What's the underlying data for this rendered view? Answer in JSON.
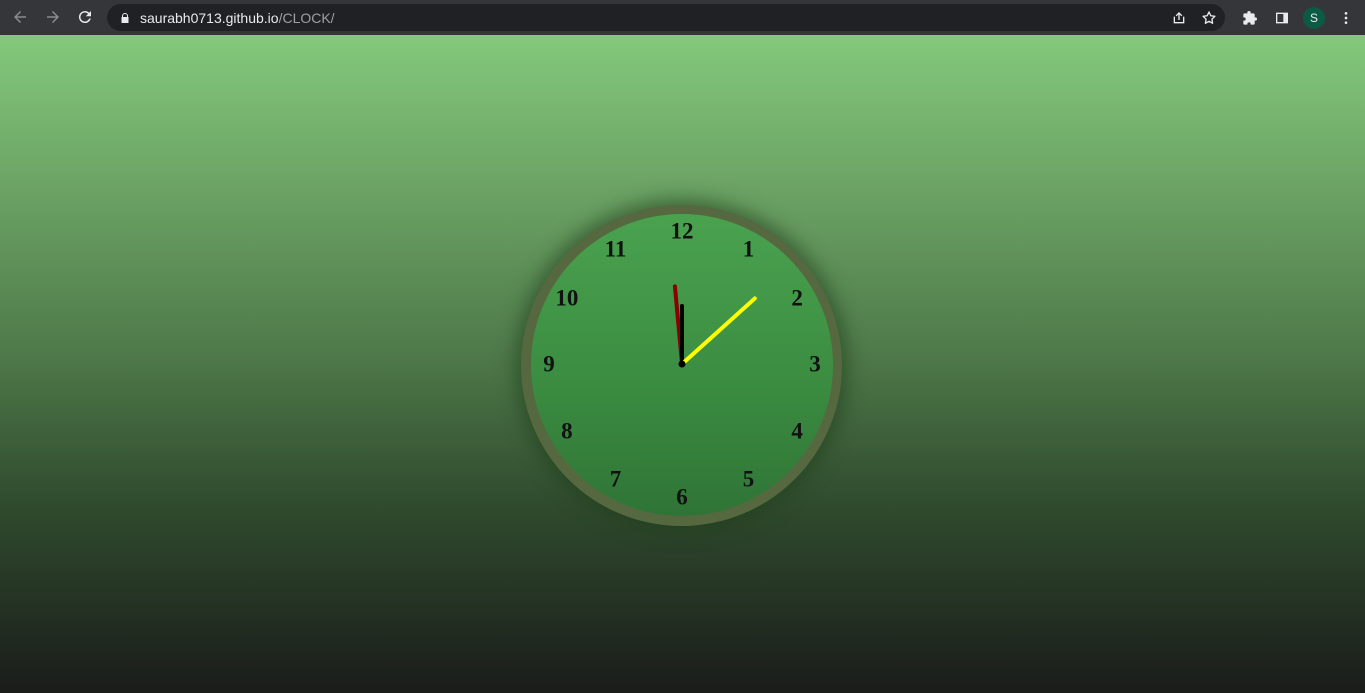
{
  "browser": {
    "url_host": "saurabh0713.github.io",
    "url_path": "/CLOCK/",
    "profile_initial": "S",
    "icons": [
      "back-arrow-icon",
      "forward-arrow-icon",
      "reload-icon",
      "lock-icon",
      "share-icon",
      "bookmark-star-icon",
      "extensions-puzzle-icon",
      "side-panel-icon",
      "kebab-menu-icon"
    ]
  },
  "clock": {
    "numbers": [
      "12",
      "1",
      "2",
      "3",
      "4",
      "5",
      "6",
      "7",
      "8",
      "9",
      "10",
      "11"
    ],
    "time": {
      "hours": 12,
      "minutes": 0,
      "seconds": 8
    },
    "colors": {
      "hour_hand": "#000000",
      "minute_hand": "#8b0000",
      "second_hand": "#ffff00",
      "rim": "#56683f",
      "face": "#3e9444"
    }
  }
}
